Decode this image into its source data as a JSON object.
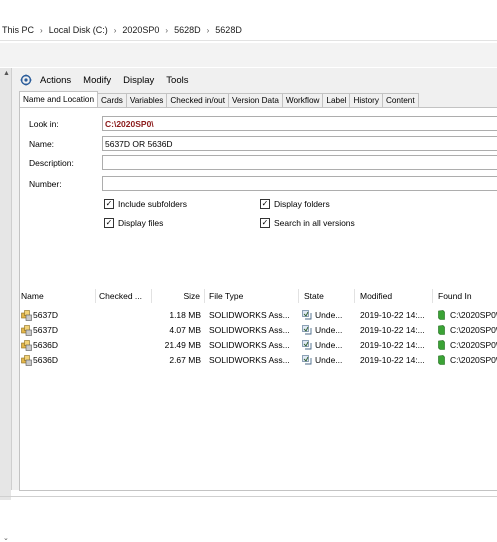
{
  "breadcrumb": [
    "This PC",
    "Local Disk (C:)",
    "2020SP0",
    "5628D",
    "5628D"
  ],
  "menu": [
    "Actions",
    "Modify",
    "Display",
    "Tools"
  ],
  "tabs": [
    "Name and Location",
    "Cards",
    "Variables",
    "Checked in/out",
    "Version Data",
    "Workflow",
    "Label",
    "History",
    "Content"
  ],
  "active_tab": "Name and Location",
  "form": {
    "look_in_label": "Look in:",
    "look_in_value": "C:\\2020SP0\\",
    "name_label": "Name:",
    "name_value": "5637D OR 5636D",
    "description_label": "Description:",
    "description_value": "",
    "number_label": "Number:",
    "number_value": ""
  },
  "checkboxes": {
    "include_subfolders": {
      "label": "Include subfolders",
      "checked": true
    },
    "display_folders": {
      "label": "Display folders",
      "checked": true
    },
    "display_files": {
      "label": "Display files",
      "checked": true
    },
    "search_all_versions": {
      "label": "Search in all versions",
      "checked": true
    }
  },
  "columns": [
    "Name",
    "Checked ...",
    "Size",
    "File Type",
    "State",
    "Modified",
    "Found In"
  ],
  "rows": [
    {
      "name": "5637D",
      "checked": "",
      "size": "1.18 MB",
      "type": "SOLIDWORKS Ass...",
      "state": "Unde...",
      "modified": "2019-10-22 14:...",
      "found_in": "C:\\2020SP0\\"
    },
    {
      "name": "5637D",
      "checked": "",
      "size": "4.07 MB",
      "type": "SOLIDWORKS Ass...",
      "state": "Unde...",
      "modified": "2019-10-22 14:...",
      "found_in": "C:\\2020SP0\\"
    },
    {
      "name": "5636D",
      "checked": "",
      "size": "21.49 MB",
      "type": "SOLIDWORKS Ass...",
      "state": "Unde...",
      "modified": "2019-10-22 14:...",
      "found_in": "C:\\2020SP0\\"
    },
    {
      "name": "5636D",
      "checked": "",
      "size": "2.67 MB",
      "type": "SOLIDWORKS Ass...",
      "state": "Unde...",
      "modified": "2019-10-22 14:...",
      "found_in": "C:\\2020SP0\\"
    }
  ],
  "icons": {
    "file": "solidworks-assembly-icon",
    "state": "workflow-state-icon",
    "found_in": "folder-green-icon",
    "menu": "search-magic-icon"
  },
  "colors": {
    "look_in_text": "#8b1a1a",
    "found_in_icon": "#3aa335"
  }
}
